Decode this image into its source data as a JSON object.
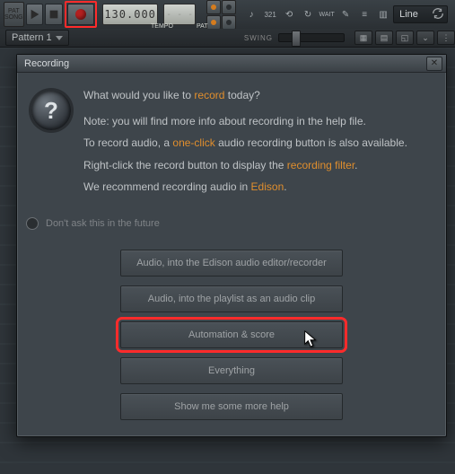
{
  "toolbar": {
    "pat_song_top": "PAT",
    "pat_song_bottom": "SONG",
    "tempo_value": "130.000",
    "tempo_label": "TEMPO",
    "pat_label": "PAT",
    "glyphs": {
      "countdown": "321",
      "wait": "WAIT"
    },
    "line_combo": "Line"
  },
  "strip2": {
    "pattern_combo": "Pattern 1",
    "swing_label": "SWING"
  },
  "dialog": {
    "title": "Recording",
    "question_pre": "What would you like to ",
    "question_hl": "record",
    "question_post": " today?",
    "line2a": "Note: you will find more info about recording in the help file.",
    "line3a": "To record audio, a ",
    "line3hl": "one-click",
    "line3b": " audio recording button is also available.",
    "line4a": "Right-click the record button to display the ",
    "line4hl": "recording filter",
    "line4b": ".",
    "line5a": "We recommend recording audio in ",
    "line5hl": "Edison",
    "line5b": ".",
    "dont_ask": "Don't ask this in the future",
    "buttons": {
      "b1": "Audio, into the Edison audio editor/recorder",
      "b2": "Audio, into the playlist as an audio clip",
      "b3": "Automation & score",
      "b4": "Everything",
      "b5": "Show me some more help"
    }
  }
}
